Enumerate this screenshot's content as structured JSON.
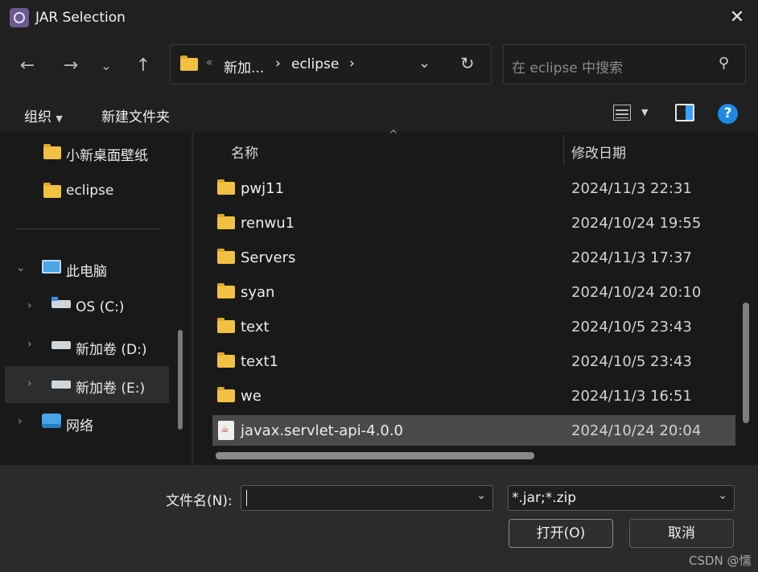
{
  "window": {
    "title": "JAR Selection"
  },
  "address": {
    "overflow": "«",
    "crumbs": [
      "新加...",
      "eclipse"
    ]
  },
  "search": {
    "placeholder": "在 eclipse 中搜索"
  },
  "toolbar": {
    "organize": "组织",
    "new_folder": "新建文件夹"
  },
  "nav": {
    "quick": [
      {
        "label": "小新桌面壁纸"
      },
      {
        "label": "eclipse"
      }
    ],
    "this_pc": "此电脑",
    "drives": [
      {
        "label": "OS (C:)"
      },
      {
        "label": "新加卷 (D:)"
      },
      {
        "label": "新加卷 (E:)",
        "selected": true
      }
    ],
    "network": "网络"
  },
  "list": {
    "columns": {
      "name": "名称",
      "date": "修改日期"
    },
    "rows": [
      {
        "name": "pwj11",
        "date": "2024/11/3 22:31",
        "type": "folder"
      },
      {
        "name": "renwu1",
        "date": "2024/10/24 19:55",
        "type": "folder"
      },
      {
        "name": "Servers",
        "date": "2024/11/3 17:37",
        "type": "folder"
      },
      {
        "name": "syan",
        "date": "2024/10/24 20:10",
        "type": "folder"
      },
      {
        "name": "text",
        "date": "2024/10/5 23:43",
        "type": "folder"
      },
      {
        "name": "text1",
        "date": "2024/10/5 23:43",
        "type": "folder"
      },
      {
        "name": "we",
        "date": "2024/11/3 16:51",
        "type": "folder"
      },
      {
        "name": "javax.servlet-api-4.0.0",
        "date": "2024/10/24 20:04",
        "type": "jar",
        "selected": true
      }
    ]
  },
  "footer": {
    "filename_label": "文件名(N):",
    "filename_value": "",
    "filter_value": "*.jar;*.zip",
    "open_label": "打开(O)",
    "cancel_label": "取消"
  },
  "watermark": "CSDN @懦",
  "colors": {
    "folder": "#f2c143",
    "help": "#1e88e5",
    "selected_row": "#4a4a4a"
  }
}
